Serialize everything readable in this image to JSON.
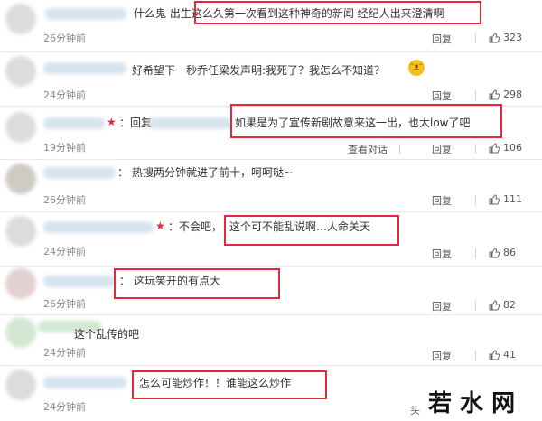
{
  "comments": [
    {
      "text": "什么鬼 出生这么久第一次看到这种神奇的新闻 经纪人出来澄清啊",
      "time": "26分钟前",
      "reply": "回复",
      "likes": "323"
    },
    {
      "text": "好希望下一秒乔任梁发声明:我死了？我怎么不知道？",
      "time": "24分钟前",
      "reply": "回复",
      "likes": "298"
    },
    {
      "prefix": "：回复",
      "text": "如果是为了宣传新剧故意来这一出，也太low了吧",
      "time": "19分钟前",
      "view": "查看对话",
      "reply": "回复",
      "likes": "106"
    },
    {
      "prefix": "：",
      "text": "热搜两分钟就进了前十，呵呵哒~",
      "time": "26分钟前",
      "reply": "回复",
      "likes": "111"
    },
    {
      "prefix": "：不会吧，",
      "text": "这个可不能乱说啊…人命关天",
      "time": "24分钟前",
      "reply": "回复",
      "likes": "86"
    },
    {
      "prefix": "：",
      "text": "这玩笑开的有点大",
      "time": "26分钟前",
      "reply": "回复",
      "likes": "82"
    },
    {
      "text": "这个乱传的吧",
      "time": "24分钟前",
      "reply": "回复",
      "likes": "41"
    },
    {
      "text": "怎么可能炒作！！谁能这么炒作",
      "time": "24分钟前"
    }
  ],
  "watermark": {
    "text": "若 水 网",
    "sub": "头"
  }
}
